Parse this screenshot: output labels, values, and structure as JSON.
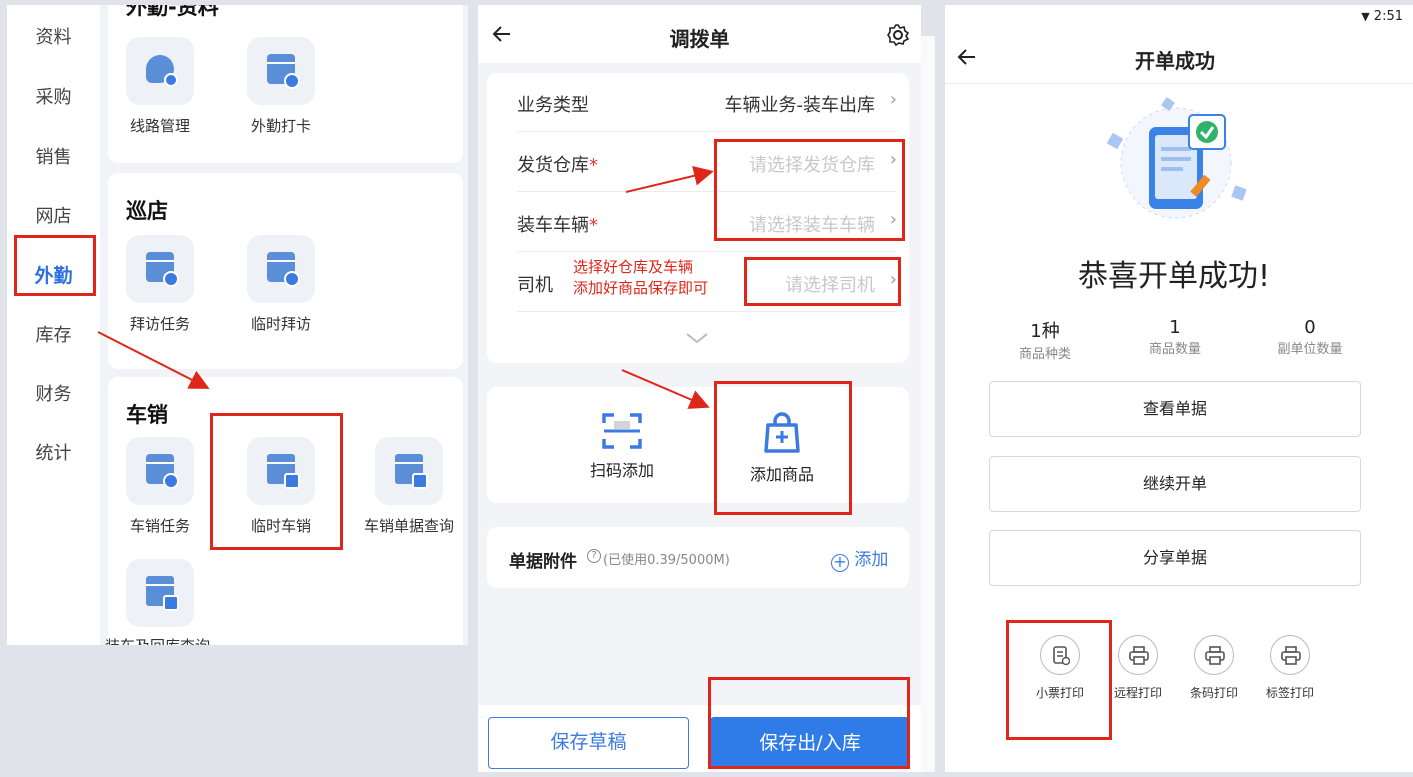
{
  "left_panel": {
    "sidebar": [
      "资料",
      "采购",
      "销售",
      "网店",
      "外勤",
      "库存",
      "财务",
      "统计"
    ],
    "active_index": 4,
    "card1": {
      "title": "外勤-资料",
      "apps": [
        "线路管理",
        "外勤打卡"
      ]
    },
    "card2": {
      "title": "巡店",
      "apps": [
        "拜访任务",
        "临时拜访"
      ]
    },
    "card3": {
      "title": "车销",
      "apps": [
        "车销任务",
        "临时车销",
        "车销单据查询",
        "装车及回库查询"
      ]
    }
  },
  "middle_panel": {
    "title": "调拨单",
    "fields": [
      {
        "label": "业务类型",
        "value": "车辆业务-装车出库",
        "required": false,
        "placeholder": false
      },
      {
        "label": "发货仓库",
        "value": "请选择发货仓库",
        "required": true,
        "placeholder": true
      },
      {
        "label": "装车车辆",
        "value": "请选择装车车辆",
        "required": true,
        "placeholder": true
      },
      {
        "label": "司机",
        "value": "请选择司机",
        "required": false,
        "placeholder": true
      }
    ],
    "annotation": [
      "选择好仓库及车辆",
      "添加好商品保存即可"
    ],
    "scan_add": "扫码添加",
    "add_product": "添加商品",
    "attachment_label": "单据附件",
    "attachment_usage": "(已使用0.39/5000M)",
    "attachment_add": "添加",
    "save_draft": "保存草稿",
    "save_stock": "保存出/入库"
  },
  "right_panel": {
    "time": "2:51",
    "title": "开单成功",
    "success_text": "恭喜开单成功!",
    "stats": [
      {
        "value": "1种",
        "label": "商品种类"
      },
      {
        "value": "1",
        "label": "商品数量"
      },
      {
        "value": "0",
        "label": "副单位数量"
      }
    ],
    "buttons": [
      "查看单据",
      "继续开单",
      "分享单据"
    ],
    "print_options": [
      "小票打印",
      "远程打印",
      "条码打印",
      "标签打印"
    ]
  },
  "colors": {
    "accent": "#3b7ae0",
    "highlight": "#e0251b"
  }
}
